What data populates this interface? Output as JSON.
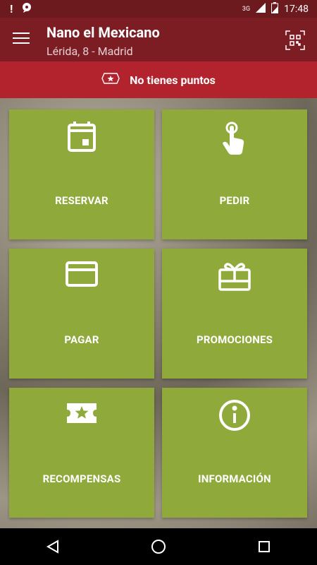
{
  "status_bar": {
    "time": "17:48",
    "network": "3G",
    "icons": [
      "alert-icon",
      "chat-icon",
      "signal-icon",
      "battery-icon"
    ]
  },
  "app_bar": {
    "title": "Nano el Mexicano",
    "subtitle": "Lérida, 8 - Madrid",
    "menu_icon": "hamburger-menu-icon",
    "qr_icon": "qr-code-icon"
  },
  "points_banner": {
    "text": "No tienes puntos",
    "icon": "badge-icon"
  },
  "tiles": [
    {
      "label": "RESERVAR",
      "icon": "calendar-icon"
    },
    {
      "label": "PEDIR",
      "icon": "touch-icon"
    },
    {
      "label": "PAGAR",
      "icon": "credit-card-icon"
    },
    {
      "label": "PROMOCIONES",
      "icon": "gift-icon"
    },
    {
      "label": "RECOMPENSAS",
      "icon": "ticket-star-icon"
    },
    {
      "label": "INFORMACIÓN",
      "icon": "info-icon"
    }
  ],
  "colors": {
    "status_bar": "#6d1a1f",
    "app_bar": "#7c1d24",
    "points_banner": "#b3232d",
    "tile": "#8fa93a"
  },
  "nav_bar": {
    "buttons": [
      "back-icon",
      "home-icon",
      "recents-icon"
    ]
  }
}
